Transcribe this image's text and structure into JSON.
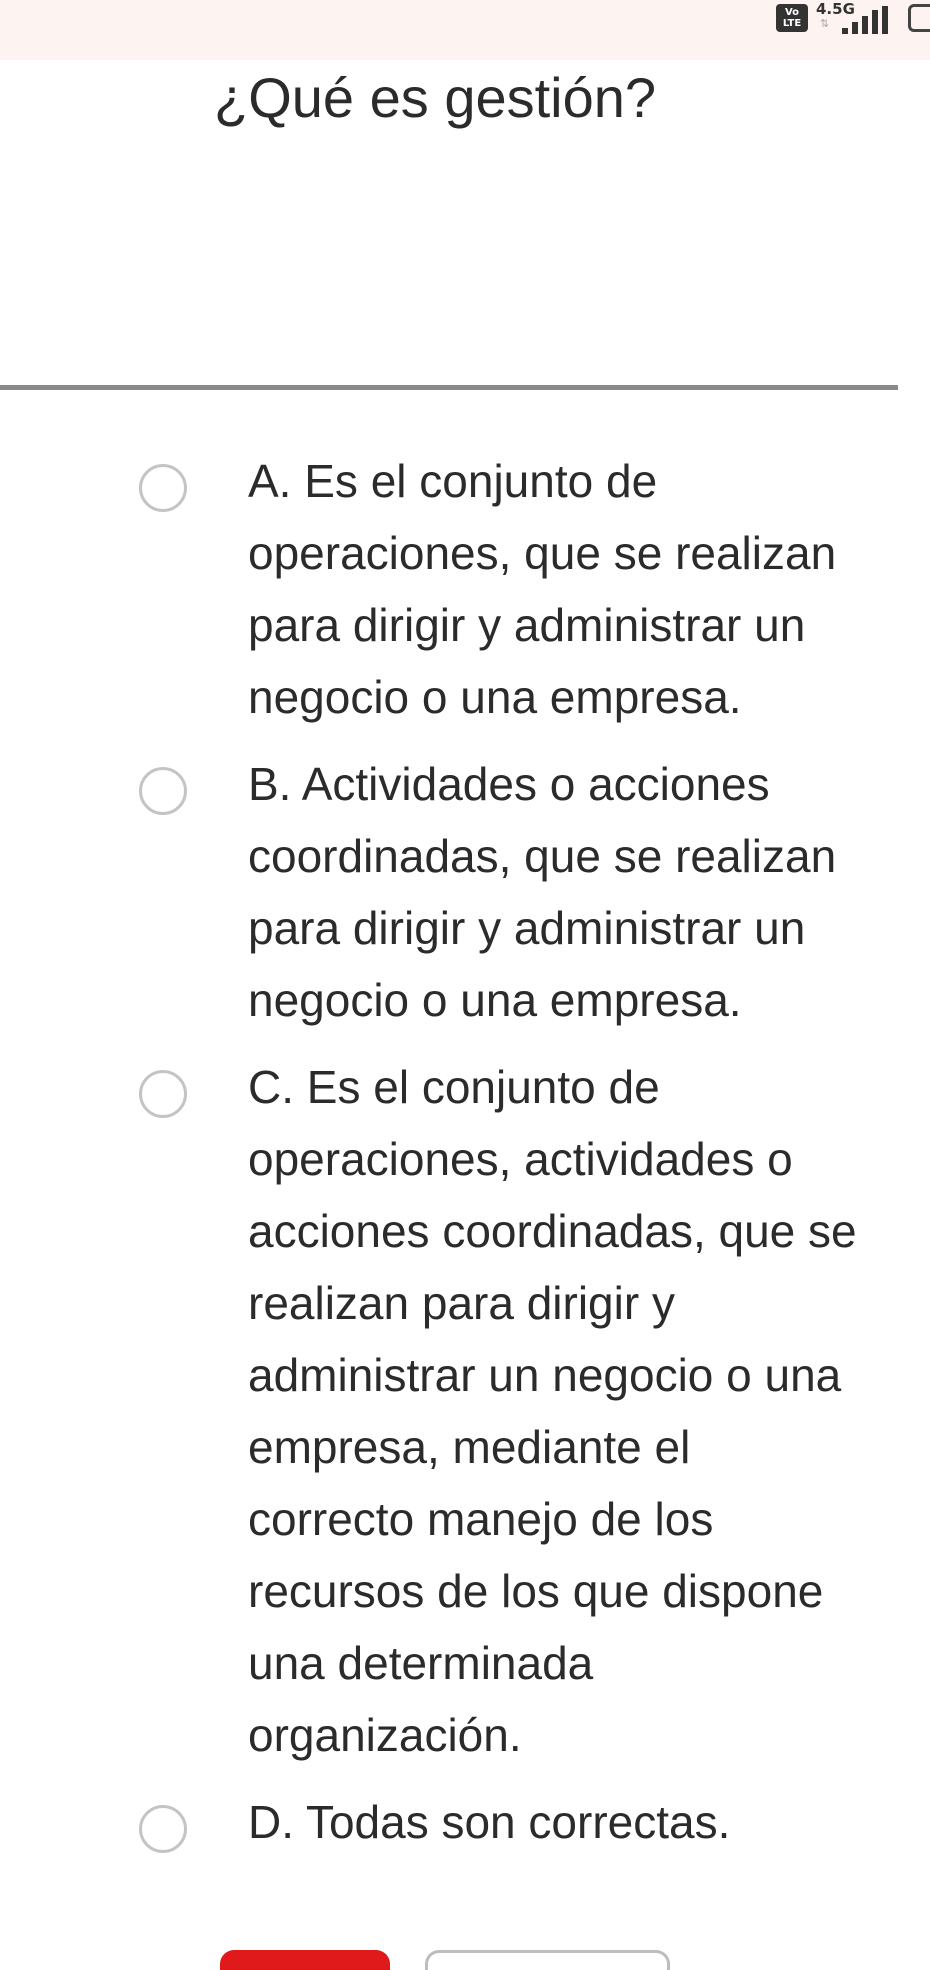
{
  "status_bar": {
    "volte_top": "Vo",
    "volte_bottom": "LTE",
    "network": "4.5G",
    "arrows": "⇅",
    "background": "#fdf3f1"
  },
  "question": {
    "title": "¿Qué es gestión?"
  },
  "options": [
    {
      "text": "A. Es el conjunto de\noperaciones, que se realizan\npara dirigir y administrar un\nnegocio o una empresa.",
      "selected": false
    },
    {
      "text": "B. Actividades o acciones\ncoordinadas, que se realizan\npara dirigir y administrar un\nnegocio o una empresa.",
      "selected": false
    },
    {
      "text": "C. Es el conjunto de\noperaciones, actividades o\nacciones coordinadas, que se\nrealizan para dirigir y\nadministrar un negocio o una\nempresa, mediante el\ncorrecto manejo de los\nrecursos de los que dispone\nuna determinada\norganización.",
      "selected": false
    },
    {
      "text": "D. Todas son correctas.",
      "selected": false
    }
  ],
  "colors": {
    "primary_button": "#e01a1a",
    "divider": "#8a8a8a",
    "radio_border": "#c4c4c4"
  }
}
